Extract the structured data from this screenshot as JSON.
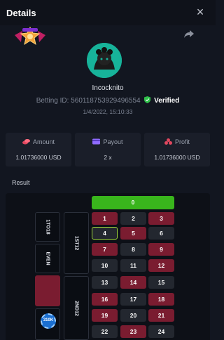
{
  "header": {
    "title": "Details",
    "close_glyph": "×"
  },
  "player": {
    "username": "Incocknito",
    "betting_id_label": "Betting ID:",
    "betting_id": "560118753929496554",
    "verified_label": "Verified",
    "datetime": "1/4/2022, 15:10:33"
  },
  "stats": [
    {
      "label": "Amount",
      "value": "1.01736000 USD",
      "icon": "coins-icon",
      "color": "#e0475e"
    },
    {
      "label": "Payout",
      "value": "2 x",
      "icon": "card-icon",
      "color": "#8f6bff"
    },
    {
      "label": "Profit",
      "value": "1.01736000 USD",
      "icon": "chips-icon",
      "color": "#e0475e"
    }
  ],
  "result": {
    "label": "Result",
    "zero": "0",
    "side_bets": {
      "low": "1TO18",
      "even": "EVEN",
      "first12": "1ST12",
      "second12": "2ND12"
    },
    "chip_label": "310K",
    "numbers": [
      {
        "n": "1",
        "c": "red"
      },
      {
        "n": "2",
        "c": "black"
      },
      {
        "n": "3",
        "c": "red"
      },
      {
        "n": "4",
        "c": "black",
        "hl": true
      },
      {
        "n": "5",
        "c": "red"
      },
      {
        "n": "6",
        "c": "black"
      },
      {
        "n": "7",
        "c": "red"
      },
      {
        "n": "8",
        "c": "black"
      },
      {
        "n": "9",
        "c": "red"
      },
      {
        "n": "10",
        "c": "black"
      },
      {
        "n": "11",
        "c": "black"
      },
      {
        "n": "12",
        "c": "red"
      },
      {
        "n": "13",
        "c": "black"
      },
      {
        "n": "14",
        "c": "red"
      },
      {
        "n": "15",
        "c": "black"
      },
      {
        "n": "16",
        "c": "red"
      },
      {
        "n": "17",
        "c": "black"
      },
      {
        "n": "18",
        "c": "red"
      },
      {
        "n": "19",
        "c": "red"
      },
      {
        "n": "20",
        "c": "black"
      },
      {
        "n": "21",
        "c": "red"
      },
      {
        "n": "22",
        "c": "black"
      },
      {
        "n": "23",
        "c": "red"
      },
      {
        "n": "24",
        "c": "black"
      }
    ]
  },
  "colors": {
    "red": "#7a1c30",
    "black": "#23272f",
    "green": "#39b51c",
    "highlight": "#9bd33a",
    "avatar_bg": "#17b39a"
  }
}
